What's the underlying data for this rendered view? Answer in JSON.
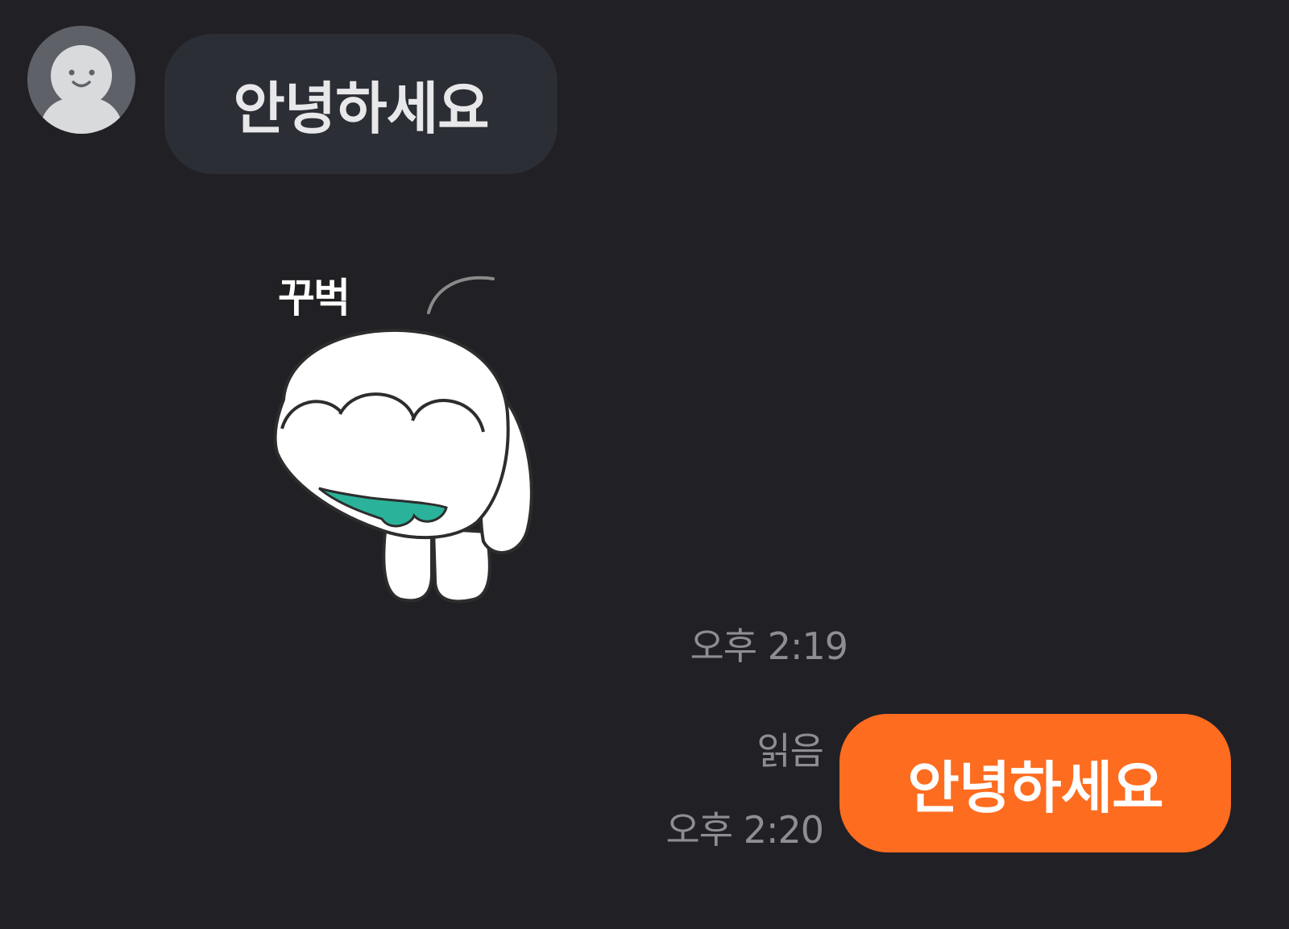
{
  "messages": {
    "received": {
      "text": "안녕하세요",
      "sticker_caption": "꾸벅",
      "time": "오후 2:19"
    },
    "sent": {
      "text": "안녕하세요",
      "read_status": "읽음",
      "time": "오후 2:20"
    }
  },
  "icons": {
    "avatar": "default-person-icon",
    "sticker": "bowing-character-sticker"
  },
  "colors": {
    "background": "#212025",
    "received_bubble": "#2c2e35",
    "sent_bubble": "#fe6c1f",
    "meta_text": "#8d8e93"
  }
}
